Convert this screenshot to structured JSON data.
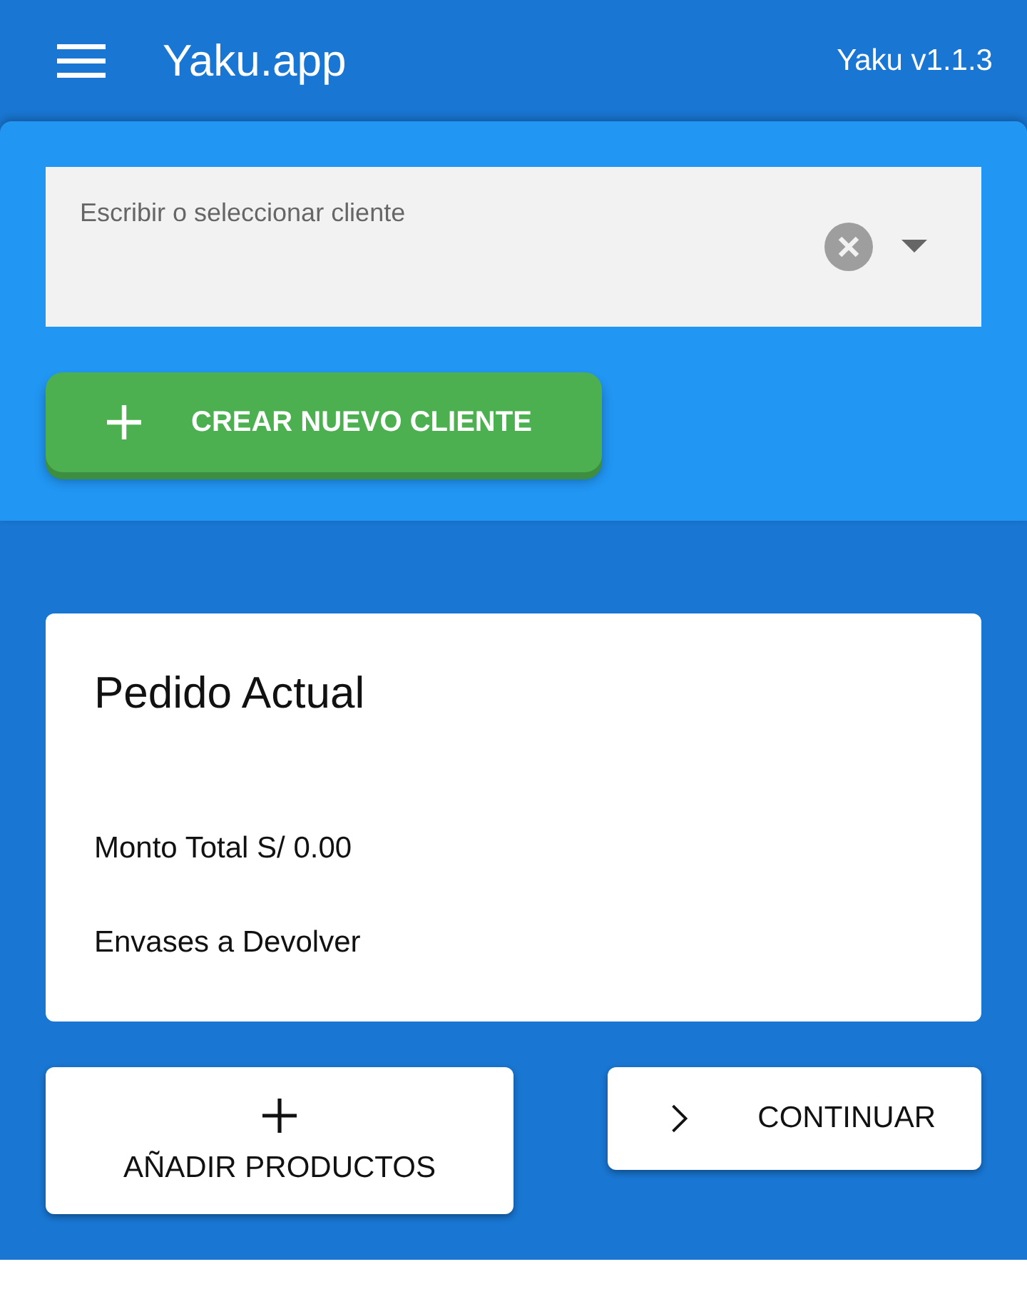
{
  "app_bar": {
    "title": "Yaku.app",
    "version": "Yaku v1.1.3"
  },
  "client_field": {
    "placeholder": "Escribir o seleccionar cliente"
  },
  "create_client_button": {
    "label": "CREAR NUEVO CLIENTE"
  },
  "order_card": {
    "title": "Pedido Actual",
    "total": "Monto Total S/ 0.00",
    "containers": "Envases a Devolver"
  },
  "add_products_button": {
    "label": "AÑADIR PRODUCTOS"
  },
  "continue_button": {
    "label": "CONTINUAR"
  }
}
